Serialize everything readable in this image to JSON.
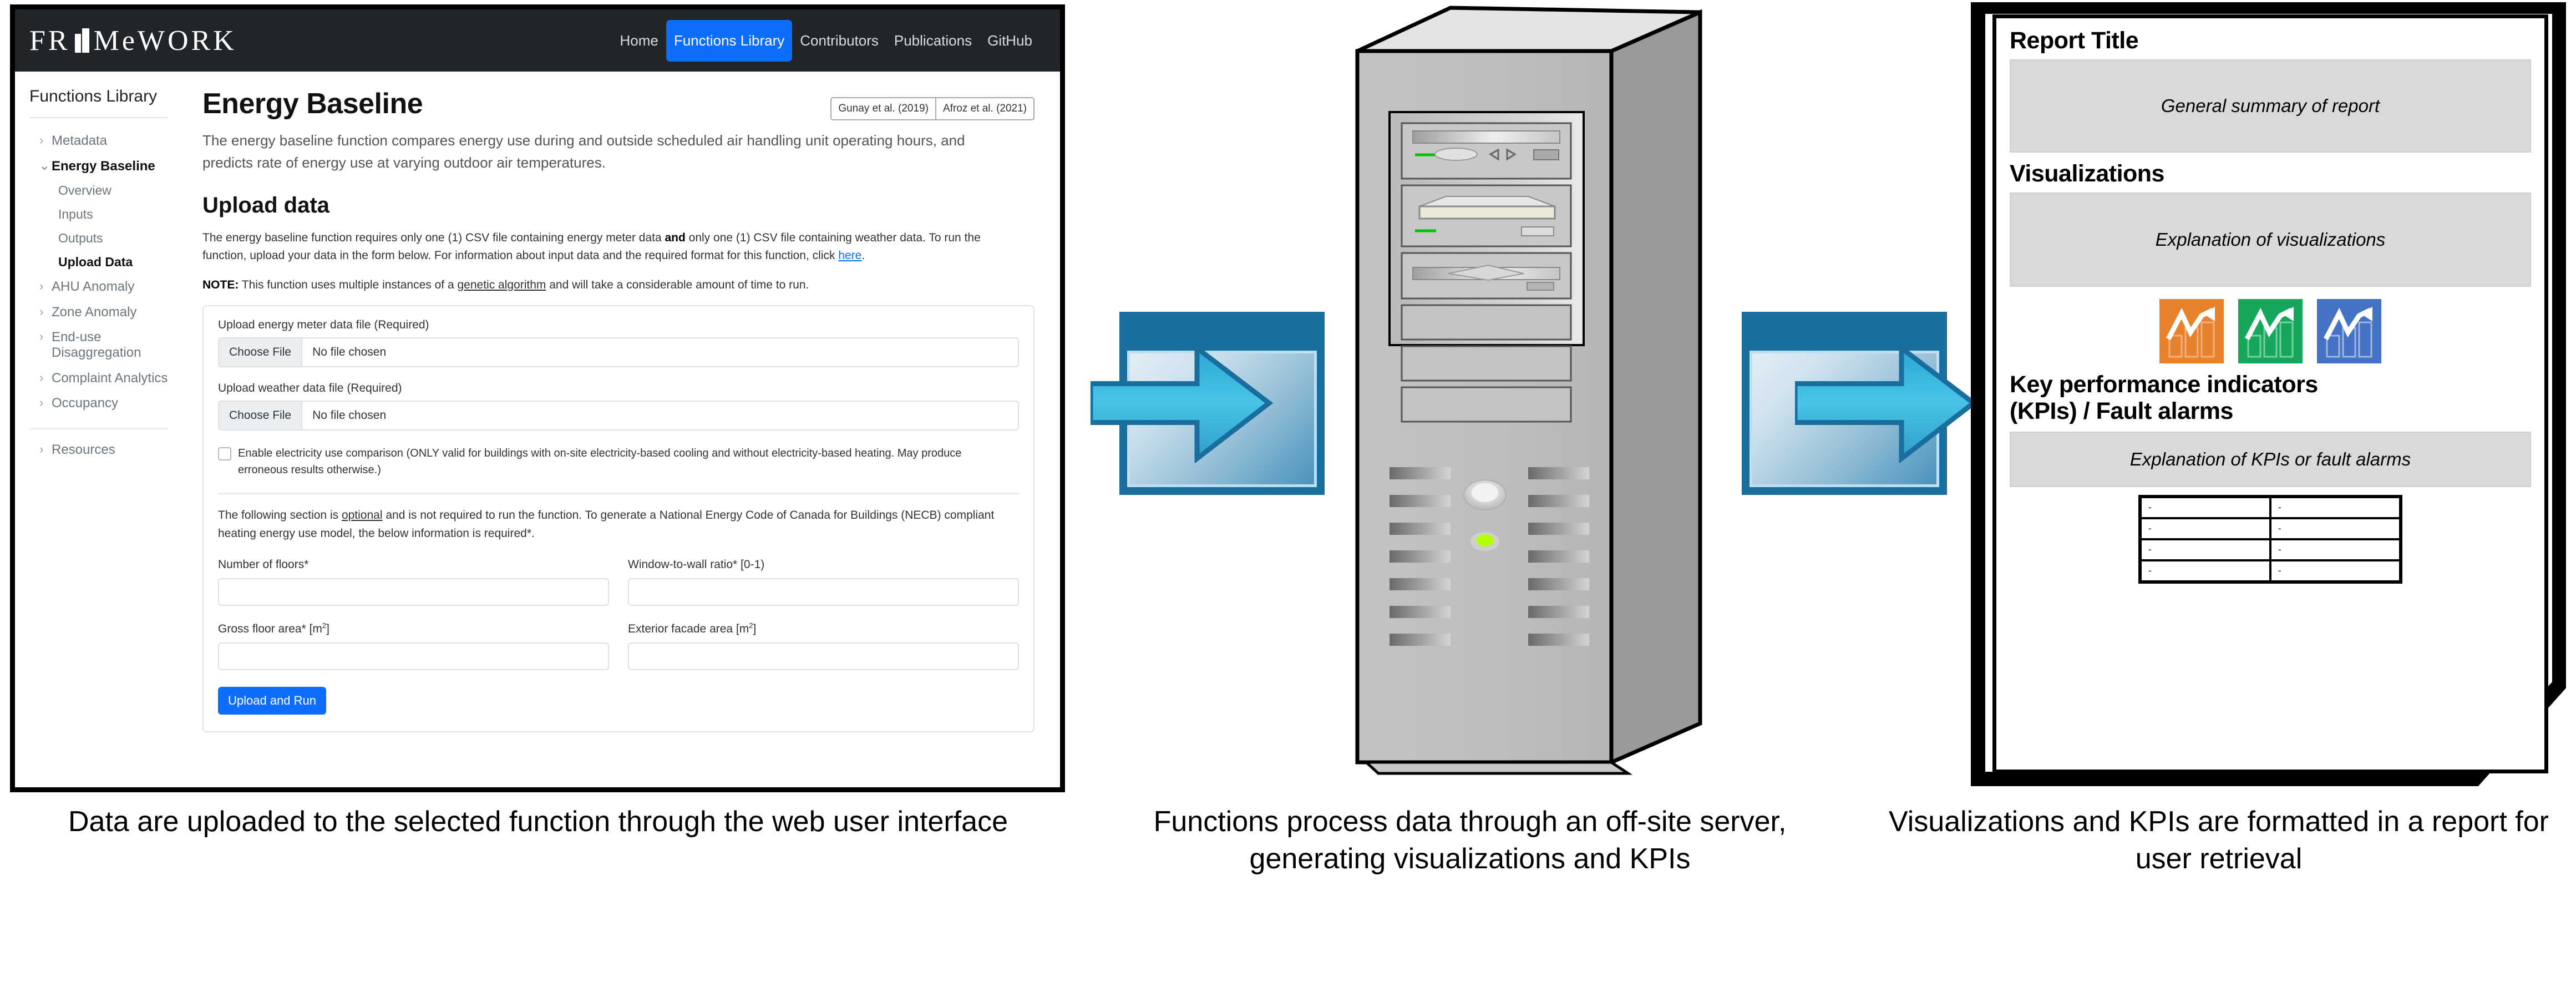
{
  "browser": {
    "navbar": {
      "brand": "FR▲MeWORK",
      "brand_parts": [
        "FR",
        "MeWORK"
      ],
      "links": [
        {
          "label": "Home",
          "active": false
        },
        {
          "label": "Functions Library",
          "active": true
        },
        {
          "label": "Contributors",
          "active": false
        },
        {
          "label": "Publications",
          "active": false
        },
        {
          "label": "GitHub",
          "active": false
        }
      ],
      "bg_color": "#212529",
      "active_color": "#0d6efd"
    },
    "sidebar": {
      "title": "Functions Library",
      "items": [
        {
          "label": "Metadata",
          "type": "group",
          "expanded": false
        },
        {
          "label": "Energy Baseline",
          "type": "group",
          "expanded": true
        },
        {
          "label": "Overview",
          "type": "sub",
          "current": false
        },
        {
          "label": "Inputs",
          "type": "sub",
          "current": false
        },
        {
          "label": "Outputs",
          "type": "sub",
          "current": false
        },
        {
          "label": "Upload Data",
          "type": "sub",
          "current": true
        },
        {
          "label": "AHU Anomaly",
          "type": "group",
          "expanded": false
        },
        {
          "label": "Zone Anomaly",
          "type": "group",
          "expanded": false
        },
        {
          "label": "End-use Disaggregation",
          "type": "group",
          "expanded": false
        },
        {
          "label": "Complaint Analytics",
          "type": "group",
          "expanded": false
        },
        {
          "label": "Occupancy",
          "type": "group",
          "expanded": false
        }
      ],
      "resources": {
        "label": "Resources",
        "expanded": false
      }
    },
    "content": {
      "title": "Energy Baseline",
      "citations": [
        "Gunay et al. (2019)",
        "Afroz et al. (2021)"
      ],
      "lede": "The energy baseline function compares energy use during and outside scheduled air handling unit operating hours, and predicts rate of energy use at varying outdoor air temperatures.",
      "section_title": "Upload data",
      "paragraph_1_a": "The energy baseline function requires only one (1) CSV file containing energy meter data ",
      "paragraph_1_bold": "and",
      "paragraph_1_b": " only one (1) CSV file containing weather data. To run the function, upload your data in the form below. For information about input data and the required format for this function, click ",
      "paragraph_1_link": "here",
      "paragraph_1_c": ".",
      "note_label": "NOTE:",
      "note_a": " This function uses multiple instances of a ",
      "note_underline": "genetic algorithm",
      "note_b": " and will take a considerable amount of time to run.",
      "form": {
        "energy_file": {
          "label": "Upload energy meter data file (Required)",
          "button": "Choose File",
          "value": "No file chosen"
        },
        "weather_file": {
          "label": "Upload weather data file (Required)",
          "button": "Choose File",
          "value": "No file chosen"
        },
        "checkbox": {
          "label": "Enable electricity use comparison (ONLY valid for buildings with on-site electricity-based cooling and without electricity-based heating. May produce erroneous results otherwise.)",
          "checked": false
        },
        "optional_note_a": "The following section is ",
        "optional_note_underline": "optional",
        "optional_note_b": " and is not required to run the function. To generate a National Energy Code of Canada for Buildings (NECB) compliant heating energy use model, the below information is required*.",
        "fields": [
          {
            "label": "Number of floors*",
            "value": ""
          },
          {
            "label": "Window-to-wall ratio* [0-1)",
            "value": ""
          },
          {
            "label": "Gross floor area* [m",
            "sup": "2",
            "suffix": "]",
            "value": ""
          },
          {
            "label": "Exterior facade area [m",
            "sup": "2",
            "suffix": "]",
            "value": ""
          }
        ],
        "submit_label": "Upload and Run"
      }
    }
  },
  "arrows": [
    {
      "name": "arrow-in",
      "direction": "right",
      "color": "#1a6e9e",
      "fill": "#3fb3dd"
    },
    {
      "name": "arrow-out",
      "direction": "right",
      "color": "#1a6e9e",
      "fill": "#3fb3dd"
    }
  ],
  "server": {
    "label": "off-site server tower",
    "power_led_color": "#b4ff00",
    "drive_led_color": "#00c000"
  },
  "report": {
    "title": "Report Title",
    "summary_placeholder": "General summary of report",
    "visualizations_heading": "Visualizations",
    "visualizations_placeholder": "Explanation of visualizations",
    "chart_icons": [
      {
        "name": "chart-icon-orange",
        "color": "#e8812c"
      },
      {
        "name": "chart-icon-green",
        "color": "#16a75c"
      },
      {
        "name": "chart-icon-blue",
        "color": "#4472c4"
      }
    ],
    "kpi_heading_line1": "Key performance indicators",
    "kpi_heading_line2": "(KPIs) / Fault alarms",
    "kpi_placeholder": "Explanation of KPIs or fault alarms",
    "kpi_table": [
      [
        "-",
        "-"
      ],
      [
        "-",
        "-"
      ],
      [
        "-",
        "-"
      ],
      [
        "-",
        "-"
      ]
    ]
  },
  "captions": {
    "left": "Data are uploaded to the selected function through the web user interface",
    "middle": "Functions process data through an off-site server, generating visualizations and KPIs",
    "right": "Visualizations and KPIs are formatted in a report for user retrieval"
  }
}
